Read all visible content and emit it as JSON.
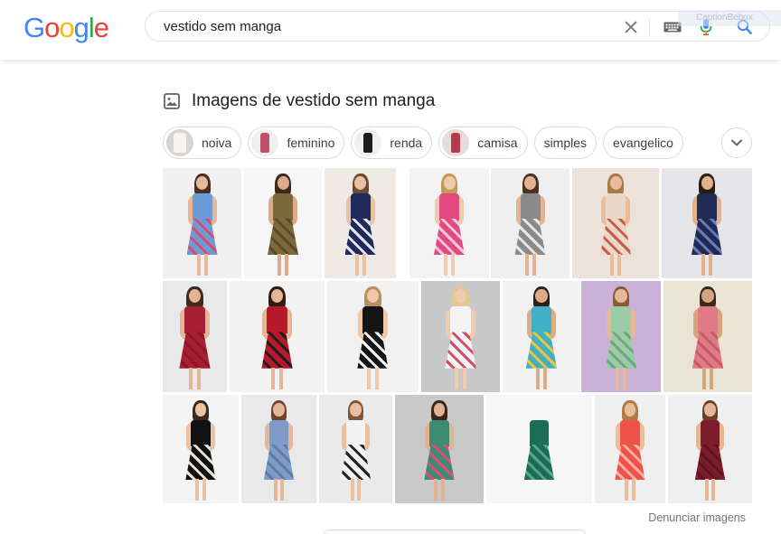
{
  "search": {
    "query": "vestido sem manga",
    "brand_colors": {
      "blue": "#4285F4",
      "red": "#EA4335",
      "yellow": "#FBBC05",
      "green": "#34A853"
    }
  },
  "logo": {
    "letters": [
      "G",
      "o",
      "o",
      "g",
      "l",
      "e"
    ]
  },
  "overlay_tag_text": "CaptionBebox",
  "images_section": {
    "title": "Imagens de vestido sem manga",
    "chips": [
      {
        "label": "noiva",
        "thumb_color": "#d9d4cf"
      },
      {
        "label": "feminino",
        "thumb_color": "#c0506a"
      },
      {
        "label": "renda",
        "thumb_color": "#1d1d1d"
      },
      {
        "label": "camisa",
        "thumb_color": "#b73a4e"
      },
      {
        "label": "simples"
      },
      {
        "label": "evangelico"
      }
    ],
    "report_link": "Denunciar imagens"
  },
  "images": [
    {
      "bg": "#f0f0f0",
      "dress": "#6a9cd8",
      "accent": "#d94c6d",
      "hair": "#4a2e22",
      "skin": "#e7b899"
    },
    {
      "bg": "#f6f6f6",
      "dress": "#7a6a3a",
      "accent": "#5b4a2b",
      "hair": "#3d2a1e",
      "skin": "#dcab8a"
    },
    {
      "bg": "#efeae4",
      "dress": "#1f2a5a",
      "accent": "#e5e5f5",
      "hair": "#6b4b32",
      "skin": "#e9c2a4"
    },
    {
      "bg": "#f3f3f3",
      "dress": "#e24a82",
      "accent": "#f7c6d7",
      "hair": "#c39a5e",
      "skin": "#f1c9ad"
    },
    {
      "bg": "#efefef",
      "dress": "#8a8a8a",
      "accent": "#e8e8e8",
      "hair": "#4b3323",
      "skin": "#e3b392"
    },
    {
      "bg": "#ece2d9",
      "dress": "#e9d8c9",
      "accent": "#c95b48",
      "hair": "#a77b4a",
      "skin": "#e7bd9b"
    },
    {
      "bg": "#e6e6ea",
      "dress": "#1f2b54",
      "accent": "#6b7bb5",
      "hair": "#2a1c14",
      "skin": "#e2b18e"
    },
    {
      "bg": "#e9e9e9",
      "dress": "#a81f32",
      "accent": "#8a1727",
      "hair": "#3e2a1e",
      "skin": "#e3b594"
    },
    {
      "bg": "#f2f2f2",
      "dress": "#b8182b",
      "accent": "#1d1d1d",
      "hair": "#2c1e16",
      "skin": "#e5b796"
    },
    {
      "bg": "#f1f1f1",
      "dress": "#151515",
      "accent": "#f4f4f4",
      "hair": "#b99060",
      "skin": "#f0c8a7"
    },
    {
      "bg": "#c8c8c8",
      "dress": "#f3f3f3",
      "accent": "#d14d6a",
      "hair": "#e2c796",
      "skin": "#f1cbae"
    },
    {
      "bg": "#f1f1f1",
      "dress": "#3fb0c6",
      "accent": "#f1c23a",
      "hair": "#2c1d15",
      "skin": "#deab86"
    },
    {
      "bg": "#c9b1d8",
      "dress": "#9ccba7",
      "accent": "#6fa582",
      "hair": "#8a5a36",
      "skin": "#e7b896"
    },
    {
      "bg": "#e8e5d4",
      "dress": "#e07b86",
      "accent": "#c55b68",
      "hair": "#3a281c",
      "skin": "#d8a37f"
    },
    {
      "bg": "#f4f4f4",
      "dress": "#111111",
      "accent": "#e9e4da",
      "hair": "#3a2a1e",
      "skin": "#ecc2a2"
    },
    {
      "bg": "#e9e9e9",
      "dress": "#7e9cc7",
      "accent": "#5e7ba6",
      "hair": "#6a4530",
      "skin": "#e4b797"
    },
    {
      "bg": "#eaeaea",
      "dress": "#f2f2f2",
      "accent": "#222222",
      "hair": "#7b5738",
      "skin": "#ebc0a0"
    },
    {
      "bg": "#c9c9c9",
      "dress": "#3c8c74",
      "accent": "#e04b7d",
      "hair": "#3a271b",
      "skin": "#e3b291"
    },
    {
      "bg": "#f6f6f6",
      "dress": "#1e6c56",
      "accent": "#57a58a",
      "hair": "#f6f6f6",
      "skin": "#f6f6f6"
    },
    {
      "bg": "#efefef",
      "dress": "#ef5347",
      "accent": "#f7b2a3",
      "hair": "#b07a45",
      "skin": "#eabd9c"
    },
    {
      "bg": "#efefef",
      "dress": "#7b1d2c",
      "accent": "#5a1520",
      "hair": "#6b4028",
      "skin": "#e5b594"
    }
  ]
}
